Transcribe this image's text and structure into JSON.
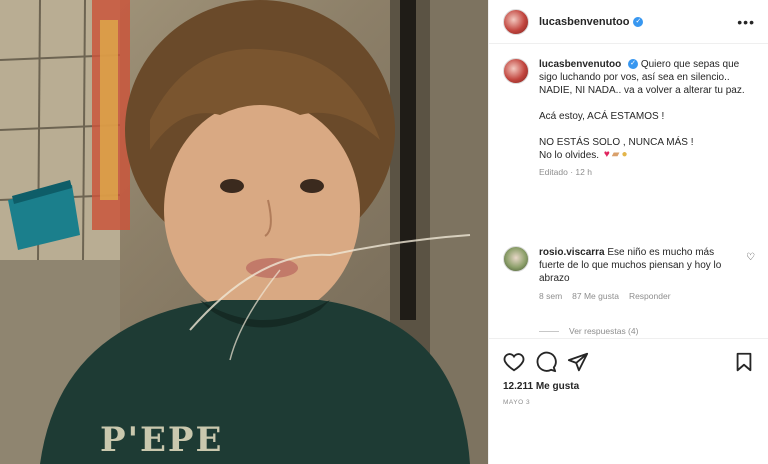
{
  "post": {
    "username": "lucasbenvenutoo",
    "verified_icon": "verified-badge-icon",
    "more_icon": "more-options-icon",
    "photo_text": "P'EPE"
  },
  "caption": {
    "username": "lucasbenvenutoo",
    "lines": [
      "Quiero que sepas que sigo luchando por vos, así sea en silencio..",
      "NADIE, NI NADA.. va a volver a alterar tu paz.",
      "Acá estoy, ACÁ ESTAMOS !",
      "NO ESTÁS SOLO , NUNCA MÁS !",
      "No lo olvides."
    ],
    "emoji_icons": [
      "red-heart-icon",
      "bandage-icon",
      "flexed-biceps-icon"
    ],
    "edited": "Editado · 12 h"
  },
  "comment": {
    "username": "rosio.viscarra",
    "text": "Ese niño es mucho más fuerte de lo que muchos piensan y hoy lo abrazo",
    "time": "8 sem",
    "likes": "87 Me gusta",
    "reply": "Responder",
    "view_replies": "Ver respuestas (4)"
  },
  "actions": {
    "icons": [
      "heart-icon",
      "comment-icon",
      "share-icon",
      "bookmark-icon"
    ],
    "likes": "12.211 Me gusta",
    "date": "MAYO 3"
  },
  "colors": {
    "verified": "#3897f0",
    "text": "#262626",
    "muted": "#8e8e8e",
    "heart": "#e0245e"
  }
}
